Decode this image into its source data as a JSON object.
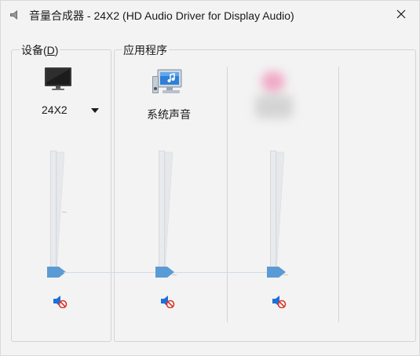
{
  "window": {
    "title": "音量合成器 - 24X2 (HD Audio Driver for Display Audio)",
    "close_icon": "close-icon",
    "title_icon": "speaker-icon"
  },
  "devices": {
    "group_label_prefix": "设备(",
    "group_label_accel": "D",
    "group_label_suffix": ")",
    "device": {
      "name": "24X2",
      "icon": "monitor-icon",
      "volume_level": 0.0,
      "muted": true
    }
  },
  "applications": {
    "group_label": "应用程序",
    "apps": [
      {
        "name": "系统声音",
        "icon": "system-sounds-icon",
        "volume_level": 0.0,
        "muted": true
      },
      {
        "name": "",
        "icon": "blurred-app-icon",
        "volume_level": 0.0,
        "muted": true
      }
    ]
  },
  "colors": {
    "thumb": "#5b9bd5",
    "mute_speaker": "#1e6fd9",
    "mute_badge": "#d9342b",
    "window_bg": "#f3f3f3",
    "group_border": "#d4d4d4"
  }
}
